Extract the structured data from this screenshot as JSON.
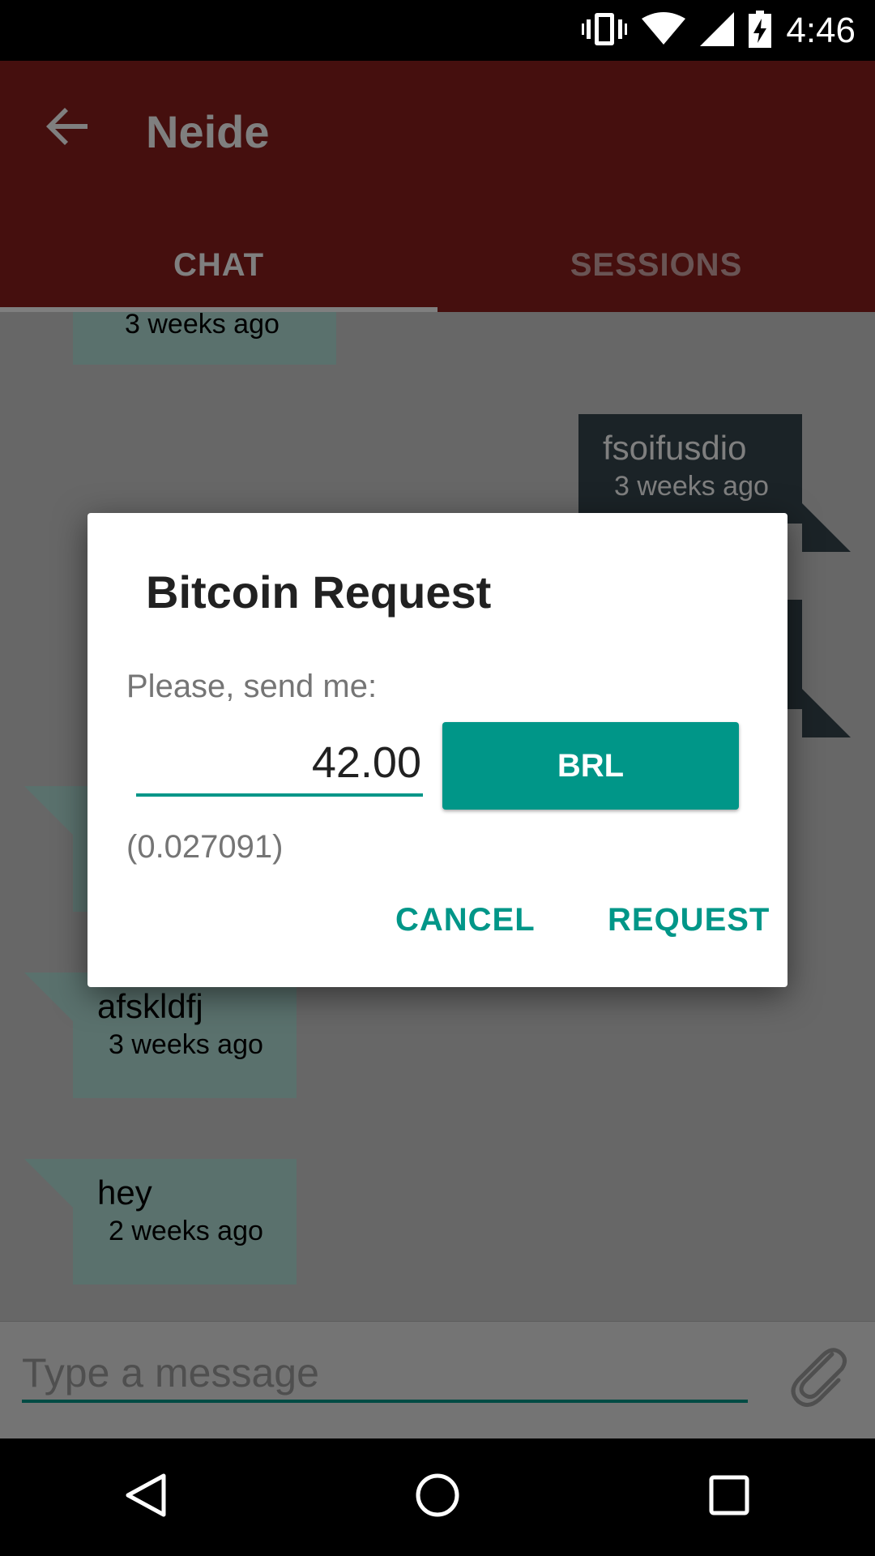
{
  "status_bar": {
    "time": "4:46",
    "icons": [
      "vibrate-icon",
      "wifi-icon",
      "signal-icon",
      "battery-charging-icon"
    ]
  },
  "app_bar": {
    "title": "Neide",
    "back_icon": "arrow-back-icon",
    "tabs": [
      {
        "label": "CHAT",
        "selected": true
      },
      {
        "label": "SESSIONS",
        "selected": false
      }
    ]
  },
  "messages": [
    {
      "direction": "incoming",
      "text": "",
      "time": "3 weeks ago"
    },
    {
      "direction": "outgoing",
      "text": "fsoifusdio",
      "time": "3 weeks ago"
    },
    {
      "direction": "incoming",
      "text": "afskldfj",
      "time": "3 weeks ago"
    },
    {
      "direction": "incoming",
      "text": "hey",
      "time": "2 weeks ago"
    }
  ],
  "composer": {
    "placeholder": "Type a message",
    "attach_icon": "paperclip-icon"
  },
  "dialog": {
    "title": "Bitcoin Request",
    "label": "Please, send me:",
    "amount": "42.00",
    "currency": "BRL",
    "converted": "(0.027091)",
    "cancel_label": "CANCEL",
    "request_label": "REQUEST"
  },
  "nav_bar": {
    "icons": [
      "nav-back-icon",
      "nav-home-icon",
      "nav-recents-icon"
    ]
  },
  "colors": {
    "primary": "#8b1e1c",
    "accent": "#009688",
    "bubble_in": "#b4e2da",
    "bubble_out": "#37474f"
  }
}
